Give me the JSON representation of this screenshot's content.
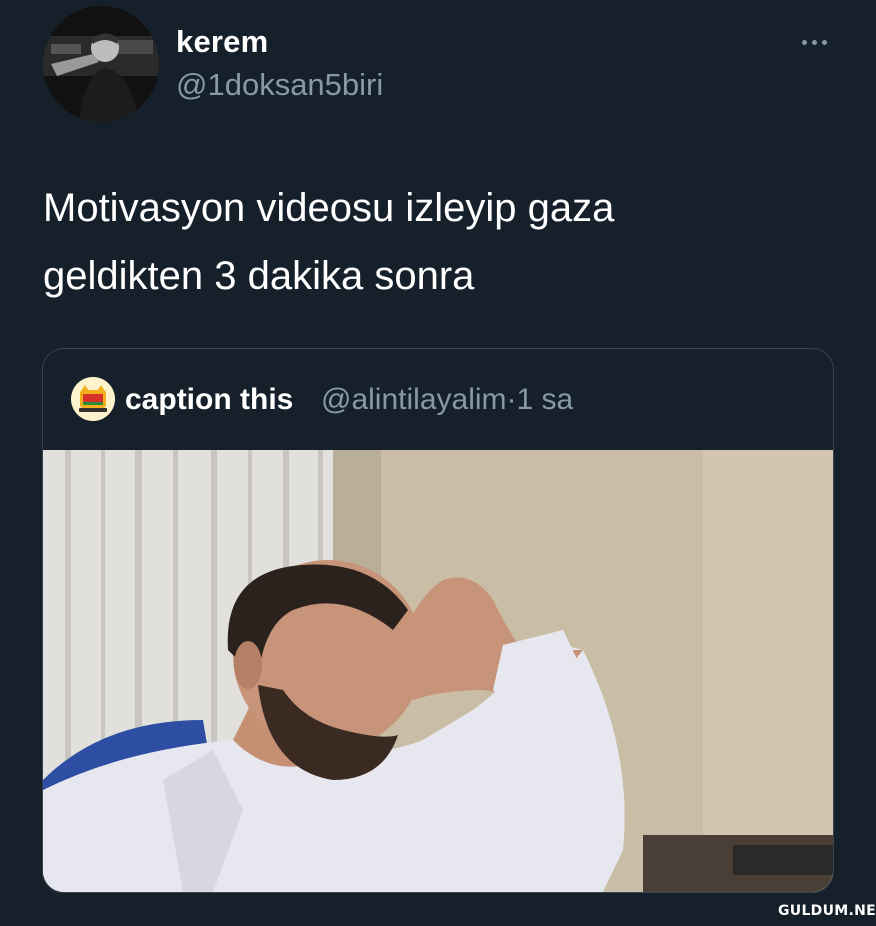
{
  "tweet": {
    "author_name": "kerem",
    "author_handle": "@1doksan5biri",
    "text": "Motivasyon videosu izleyip gaza\ngeldikten 3 dakika sonra",
    "more_icon": "more-horizontal-icon"
  },
  "quote": {
    "author_name": "caption this",
    "author_handle": "@alintilayalim",
    "separator": "·",
    "time": "1 sa",
    "media_description_icon": "video-still"
  },
  "watermark": "GULDUM.NET",
  "colors": {
    "background": "#15202b",
    "text_primary": "#ffffff",
    "text_secondary": "#8899a6",
    "border": "#38444d"
  }
}
